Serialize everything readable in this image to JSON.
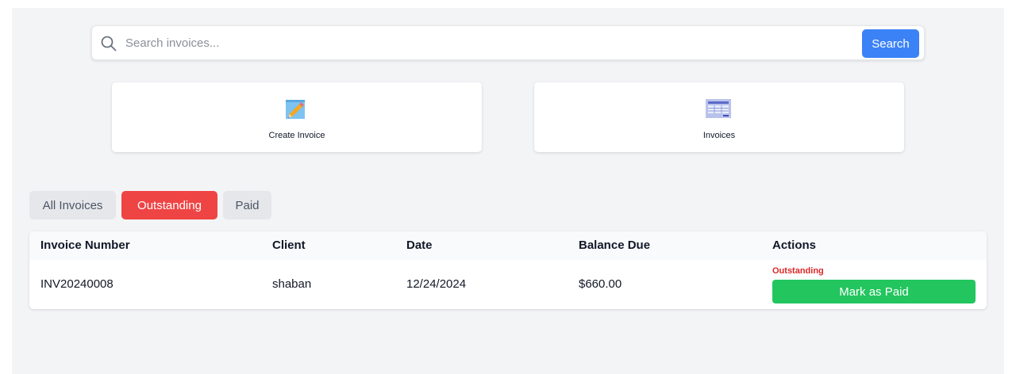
{
  "search": {
    "placeholder": "Search invoices...",
    "value": "",
    "button_label": "Search"
  },
  "quick_actions": {
    "create": {
      "label": "Create Invoice",
      "icon": "pencil-memo-icon"
    },
    "invoices": {
      "label": "Invoices",
      "icon": "spreadsheet-icon"
    }
  },
  "tabs": [
    {
      "label": "All Invoices",
      "active": false
    },
    {
      "label": "Outstanding",
      "active": true
    },
    {
      "label": "Paid",
      "active": false
    }
  ],
  "table": {
    "headers": [
      "Invoice Number",
      "Client",
      "Date",
      "Balance Due",
      "Actions"
    ],
    "rows": [
      {
        "invoice_number": "INV20240008",
        "client": "shaban",
        "date": "12/24/2024",
        "balance_due": "$660.00",
        "status": "Outstanding",
        "action_label": "Mark as Paid"
      }
    ]
  },
  "colors": {
    "search_button": "#3b82f6",
    "active_tab": "#ef4444",
    "status_outstanding": "#dc2626",
    "mark_paid_button": "#22c55e"
  }
}
